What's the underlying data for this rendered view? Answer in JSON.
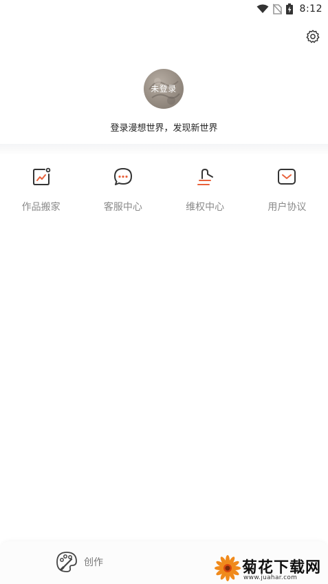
{
  "status_bar": {
    "time": "8:12"
  },
  "profile": {
    "avatar_label": "未登录",
    "login_prompt": "登录漫想世界，发现新世界"
  },
  "quick_menu": [
    {
      "label": "作品搬家",
      "icon": "chart-export-icon"
    },
    {
      "label": "客服中心",
      "icon": "chat-bubble-icon"
    },
    {
      "label": "维权中心",
      "icon": "gavel-icon"
    },
    {
      "label": "用户协议",
      "icon": "envelope-icon"
    }
  ],
  "bottom_nav": {
    "create_label": "创作"
  },
  "watermark": {
    "title": "菊花下载网",
    "url": "www.juahar.com"
  },
  "colors": {
    "accent": "#e8623c",
    "icon_dark": "#333333",
    "label_gray": "#8a8a8a"
  }
}
